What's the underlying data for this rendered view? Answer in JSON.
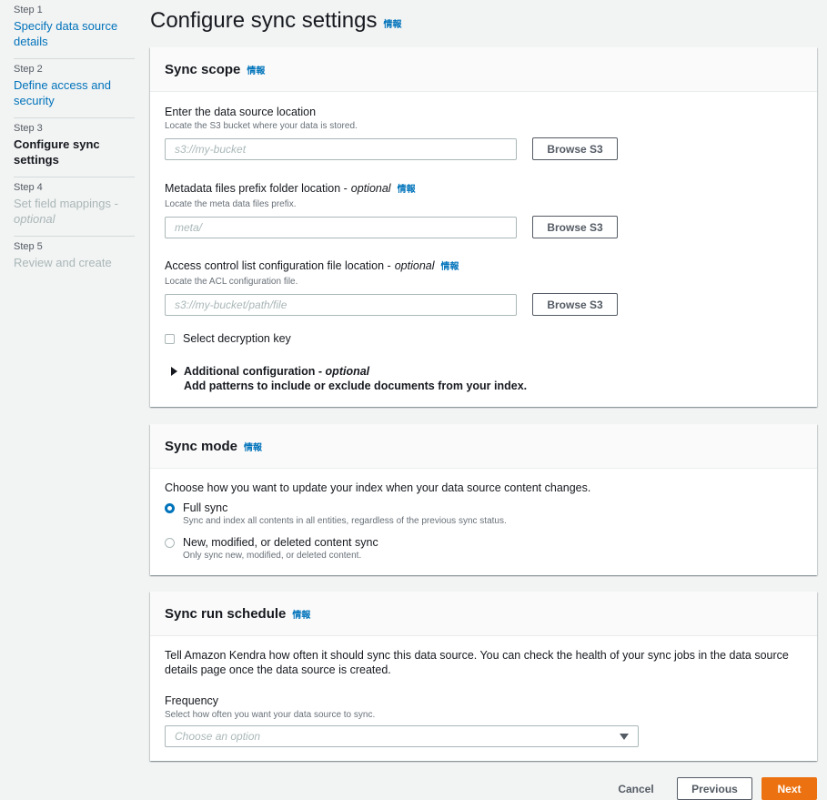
{
  "steps": [
    {
      "num": "Step 1",
      "title": "Specify data source details",
      "state": "link"
    },
    {
      "num": "Step 2",
      "title": "Define access and security",
      "state": "link"
    },
    {
      "num": "Step 3",
      "title": "Configure sync settings",
      "state": "current"
    },
    {
      "num": "Step 4",
      "title": "Set field mappings - ",
      "title_optional": "optional",
      "state": "disabled"
    },
    {
      "num": "Step 5",
      "title": "Review and create",
      "state": "disabled"
    }
  ],
  "page": {
    "title": "Configure sync settings",
    "info": "情報"
  },
  "sync_scope": {
    "title": "Sync scope",
    "info": "情報",
    "location": {
      "label": "Enter the data source location",
      "desc": "Locate the S3 bucket where your data is stored.",
      "placeholder": "s3://my-bucket",
      "button": "Browse S3"
    },
    "metadata": {
      "label": "Metadata files prefix folder location -",
      "optional": "optional",
      "info": "情報",
      "desc": "Locate the meta data files prefix.",
      "placeholder": "meta/",
      "button": "Browse S3"
    },
    "acl": {
      "label": "Access control list configuration file location -",
      "optional": "optional",
      "info": "情報",
      "desc": "Locate the ACL configuration file.",
      "placeholder": "s3://my-bucket/path/file",
      "button": "Browse S3"
    },
    "decryption_checkbox": "Select decryption key",
    "additional": {
      "title": "Additional configuration - ",
      "optional": "optional",
      "desc": "Add patterns to include or exclude documents from your index."
    }
  },
  "sync_mode": {
    "title": "Sync mode",
    "info": "情報",
    "intro": "Choose how you want to update your index when your data source content changes.",
    "full": {
      "label": "Full sync",
      "desc": "Sync and index all contents in all entities, regardless of the previous sync status.",
      "checked": true
    },
    "delta": {
      "label": "New, modified, or deleted content sync",
      "desc": "Only sync new, modified, or deleted content.",
      "checked": false
    }
  },
  "schedule": {
    "title": "Sync run schedule",
    "info": "情報",
    "intro": "Tell Amazon Kendra how often it should sync this data source. You can check the health of your sync jobs in the data source details page once the data source is created.",
    "frequency_label": "Frequency",
    "frequency_desc": "Select how often you want your data source to sync.",
    "placeholder": "Choose an option"
  },
  "footer": {
    "cancel": "Cancel",
    "previous": "Previous",
    "next": "Next"
  },
  "colors": {
    "link": "#0073bb",
    "primary": "#ec7211",
    "background": "#f2f3f3"
  }
}
